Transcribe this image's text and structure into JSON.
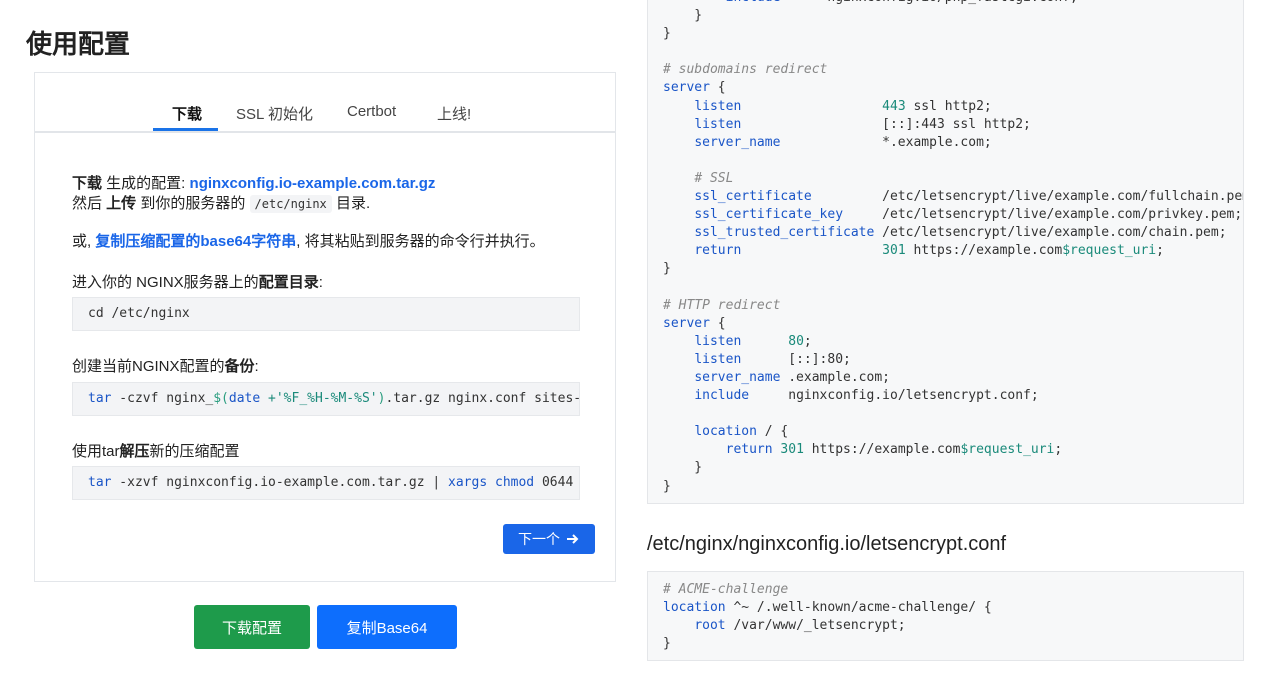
{
  "section_title": "使用配置",
  "tabs": [
    "下载",
    "SSL 初始化",
    "Certbot",
    "上线!"
  ],
  "download": {
    "line1_strong": "下载",
    "line1_text": " 生成的配置: ",
    "line1_link": "nginxconfig.io-example.com.tar.gz",
    "line2_prefix": "然后 ",
    "line2_strong": "上传",
    "line2_text": " 到你的服务器的 ",
    "line2_code": "/etc/nginx",
    "line2_suffix": " 目录.",
    "alt_prefix": "或, ",
    "alt_link": "复制压缩配置的base64字符串",
    "alt_suffix": ", 将其粘贴到服务器的命令行并执行。"
  },
  "steps": [
    {
      "label_text": "进入你的 NGINX服务器上的",
      "label_strong": "配置目录",
      "label_suffix": ":"
    },
    {
      "label_text": "创建当前NGINX配置的",
      "label_strong": "备份",
      "label_suffix": ":"
    },
    {
      "label_text": "使用tar",
      "label_strong": "解压",
      "label_suffix": "新的压缩配置"
    }
  ],
  "commands": {
    "cd": "cd /etc/nginx",
    "backup": {
      "tar": "tar",
      "opts": " -czvf nginx_",
      "sub_open": "$(",
      "date": "date",
      "fmt": " +'%F_%H-%M-%S'",
      "sub_close": ")",
      "rest": ".tar.gz nginx.conf sites-available/ sites-enabled/ nginxconfig.io/"
    },
    "extract": {
      "tar": "tar",
      "opts": " -xzvf nginxconfig.io-example.com.tar.gz | ",
      "xargs": "xargs",
      "chmod": "chmod",
      "mode": " 0644"
    }
  },
  "buttons": {
    "next": "下一个",
    "download_config": "下载配置",
    "copy_base64": "复制Base64"
  },
  "icons": {
    "next_arrow": "arrow-right-icon"
  },
  "right_file_title": "/etc/nginx/nginxconfig.io/letsencrypt.conf",
  "colors": {
    "primary": "#1a66e8",
    "success": "#1e9b4b",
    "code_keyword": "#1a55c7",
    "code_number": "#1a8a7a"
  }
}
